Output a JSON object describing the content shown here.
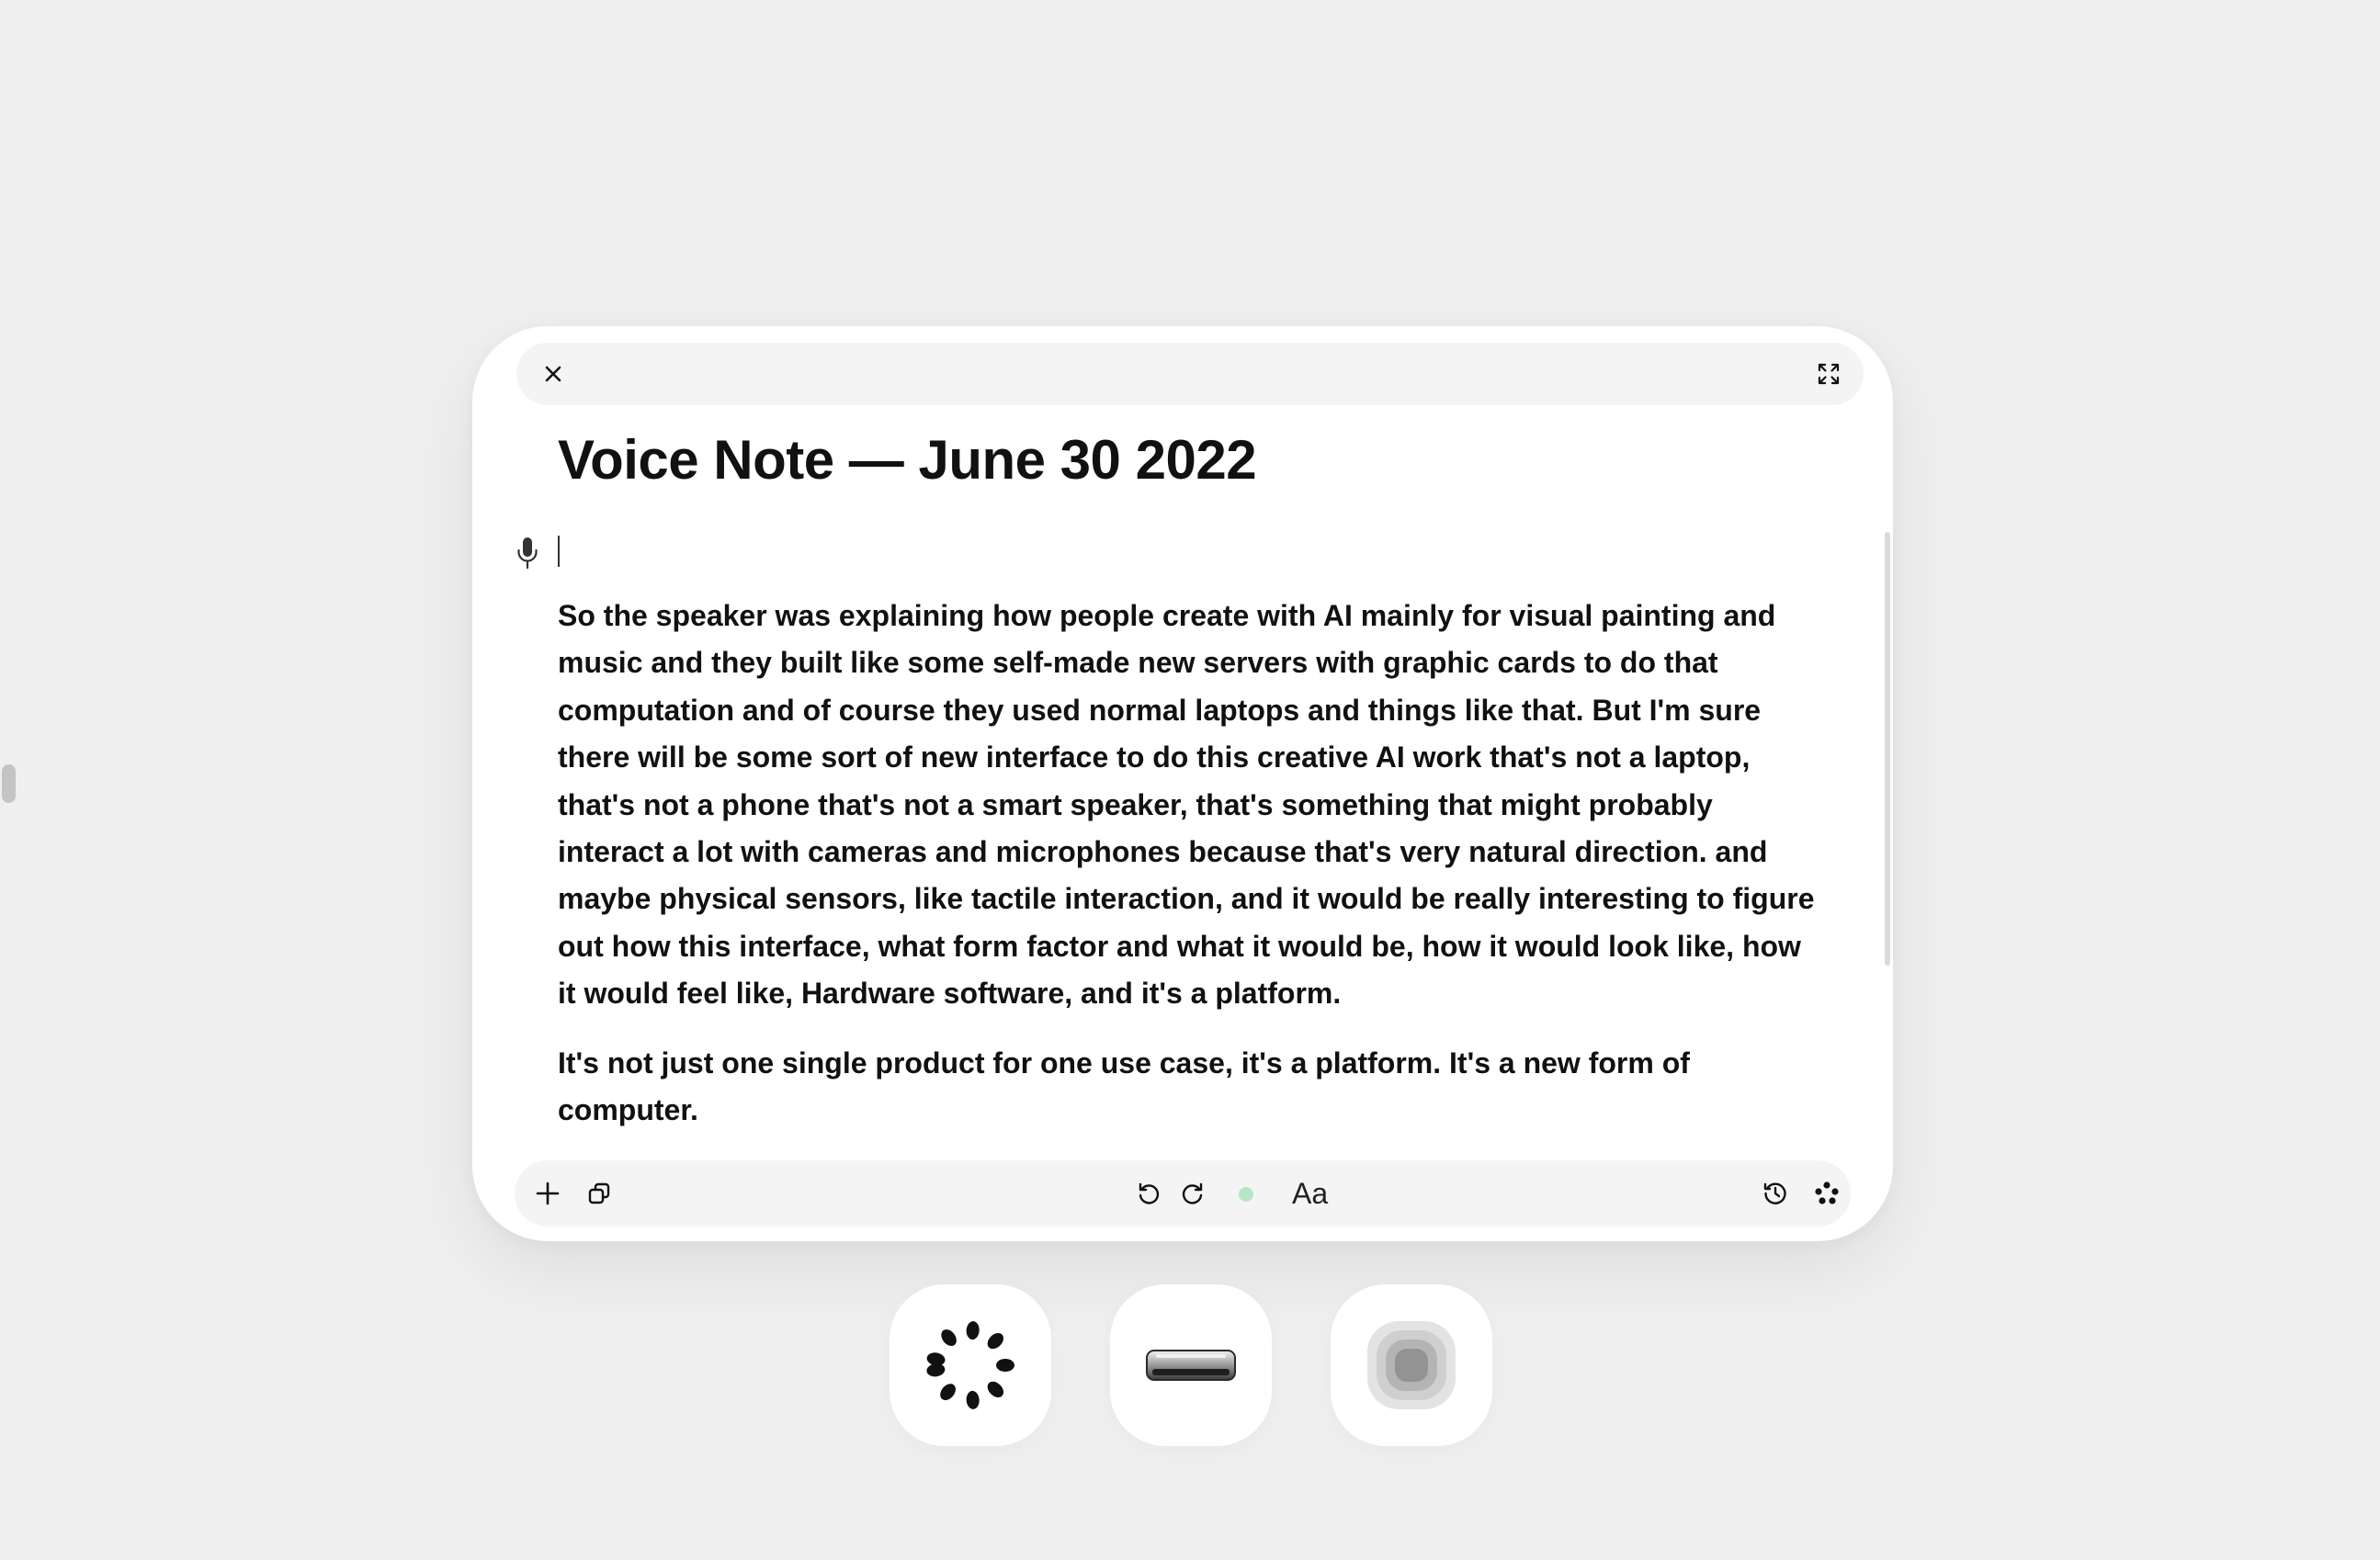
{
  "window": {
    "title": "Voice Note — June 30 2022",
    "close_icon": "close-icon",
    "expand_icon": "expand-icon"
  },
  "editor": {
    "mic_icon": "microphone-icon",
    "paragraphs": [
      "So the speaker was explaining how people create with AI mainly for visual painting and music and they built like some self-made new servers with graphic cards to do that computation and of course they used normal laptops and things like that. But I'm sure there will be some sort of new interface to do this creative AI work that's not a laptop, that's not a phone that's not a smart speaker, that's something that might probably interact a lot with cameras and microphones because that's very natural direction. and maybe physical sensors, like tactile interaction, and it would be really interesting to figure out how this interface, what form factor and what it would be, how it would look like, how it would feel like, Hardware software, and it's a platform.",
      "It's not just one single product for one use case, it's a platform. It's a new form of computer."
    ]
  },
  "toolbar": {
    "add_icon": "plus-icon",
    "duplicate_icon": "duplicate-icon",
    "undo_icon": "undo-icon",
    "redo_icon": "redo-icon",
    "status_color": "#b7e6c6",
    "font_label": "Aa",
    "history_icon": "history-icon",
    "more_icon": "dots-cluster-icon"
  },
  "dock": {
    "items": [
      {
        "icon": "petal-ring-icon"
      },
      {
        "icon": "device-bar-icon"
      },
      {
        "icon": "concentric-square-icon"
      }
    ]
  },
  "colors": {
    "background": "#efefef",
    "window": "#ffffff",
    "bar": "#f4f4f4",
    "text": "#111111"
  }
}
